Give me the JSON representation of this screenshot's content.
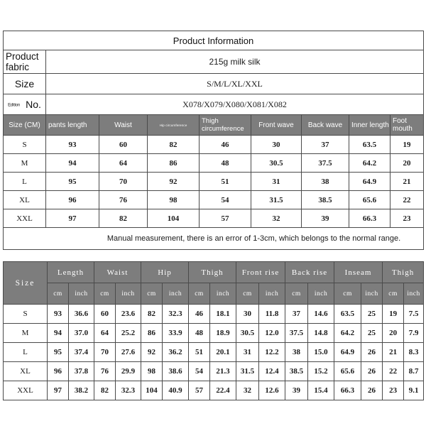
{
  "product_info": {
    "title": "Product Information",
    "rows": [
      {
        "label": "Product fabric",
        "value": "215g milk silk"
      },
      {
        "label": "Size",
        "value": "S/M/L/XL/XXL"
      },
      {
        "label_small": "Edition",
        "label": "No.",
        "value": "X078/X079/X080/X081/X082"
      }
    ]
  },
  "size_table_cm": {
    "headers": [
      "Size (CM)",
      "pants length",
      "Waist",
      "Hip circumference",
      "Thigh circumference",
      "Front wave",
      "Back wave",
      "Inner length",
      "Foot mouth"
    ],
    "rows": [
      {
        "size": "S",
        "values": [
          "93",
          "60",
          "82",
          "46",
          "30",
          "37",
          "63.5",
          "19"
        ]
      },
      {
        "size": "M",
        "values": [
          "94",
          "64",
          "86",
          "48",
          "30.5",
          "37.5",
          "64.2",
          "20"
        ]
      },
      {
        "size": "L",
        "values": [
          "95",
          "70",
          "92",
          "51",
          "31",
          "38",
          "64.9",
          "21"
        ]
      },
      {
        "size": "XL",
        "values": [
          "96",
          "76",
          "98",
          "54",
          "31.5",
          "38.5",
          "65.6",
          "22"
        ]
      },
      {
        "size": "XXL",
        "values": [
          "97",
          "82",
          "104",
          "57",
          "32",
          "39",
          "66.3",
          "23"
        ]
      }
    ],
    "note": "Manual measurement, there is an error of 1-3cm, which belongs to the normal range."
  },
  "size_table_dual": {
    "size_header": "Size",
    "groups": [
      "Length",
      "Waist",
      "Hip",
      "Thigh",
      "Front rise",
      "Back rise",
      "Inseam",
      "Thigh"
    ],
    "units": [
      "cm",
      "inch"
    ],
    "rows": [
      {
        "size": "S",
        "values": [
          "93",
          "36.6",
          "60",
          "23.6",
          "82",
          "32.3",
          "46",
          "18.1",
          "30",
          "11.8",
          "37",
          "14.6",
          "63.5",
          "25",
          "19",
          "7.5"
        ]
      },
      {
        "size": "M",
        "values": [
          "94",
          "37.0",
          "64",
          "25.2",
          "86",
          "33.9",
          "48",
          "18.9",
          "30.5",
          "12.0",
          "37.5",
          "14.8",
          "64.2",
          "25",
          "20",
          "7.9"
        ]
      },
      {
        "size": "L",
        "values": [
          "95",
          "37.4",
          "70",
          "27.6",
          "92",
          "36.2",
          "51",
          "20.1",
          "31",
          "12.2",
          "38",
          "15.0",
          "64.9",
          "26",
          "21",
          "8.3"
        ]
      },
      {
        "size": "XL",
        "values": [
          "96",
          "37.8",
          "76",
          "29.9",
          "98",
          "38.6",
          "54",
          "21.3",
          "31.5",
          "12.4",
          "38.5",
          "15.2",
          "65.6",
          "26",
          "22",
          "8.7"
        ]
      },
      {
        "size": "XXL",
        "values": [
          "97",
          "38.2",
          "82",
          "32.3",
          "104",
          "40.9",
          "57",
          "22.4",
          "32",
          "12.6",
          "39",
          "15.4",
          "66.3",
          "26",
          "23",
          "9.1"
        ]
      }
    ]
  },
  "colors": {
    "header_gray": "#7d7d7d",
    "border": "#4a4a4a",
    "text": "#1a1a1a",
    "background": "#ffffff"
  }
}
